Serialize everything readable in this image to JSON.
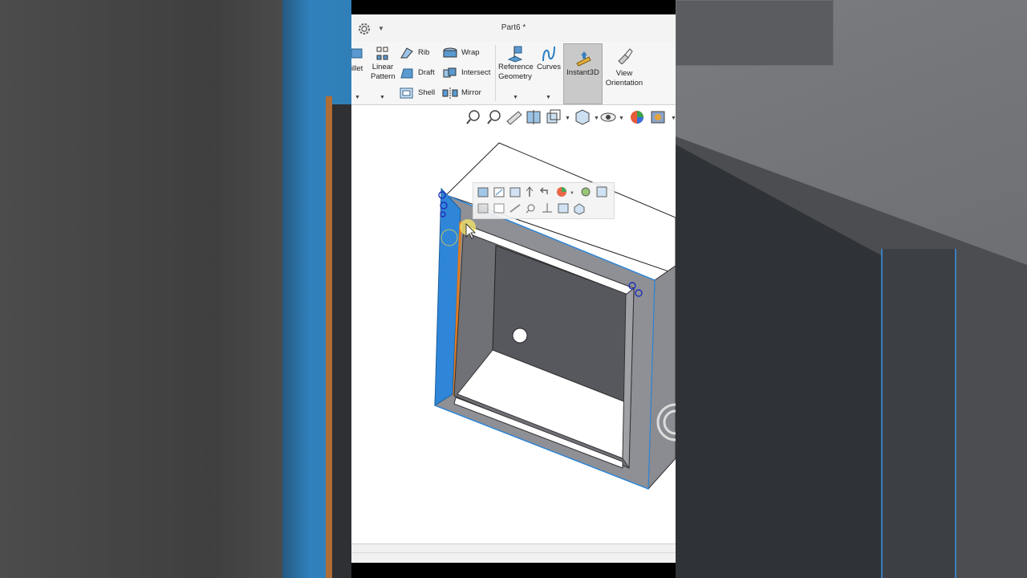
{
  "window": {
    "document_title": "Part6 *",
    "settings_icon": "gear-icon"
  },
  "ribbon": {
    "fillet_label": "illet",
    "linear_pattern_label_1": "Linear",
    "linear_pattern_label_2": "Pattern",
    "rib_label": "Rib",
    "draft_label": "Draft",
    "shell_label": "Shell",
    "wrap_label": "Wrap",
    "intersect_label": "Intersect",
    "mirror_label": "Mirror",
    "reference_geometry_label_1": "Reference",
    "reference_geometry_label_2": "Geometry",
    "curves_label": "Curves",
    "instant3d_label": "Instant3D",
    "view_orientation_label_1": "View",
    "view_orientation_label_2": "Orientation",
    "instant3d_active": true
  },
  "heads_up_toolbar": {
    "icons": [
      "zoom-to-fit-icon",
      "zoom-area-icon",
      "previous-view-icon",
      "section-view-icon",
      "view-orientation-icon",
      "display-style-icon",
      "hide-show-icon",
      "appearance-icon",
      "scene-icon"
    ]
  },
  "context_toolbar": {
    "row1": [
      "feature-icon",
      "edit-sketch-icon",
      "pattern-icon",
      "normal-to-icon",
      "rollback-icon",
      "appearance-icon",
      "zoom-icon",
      "hide-icon"
    ],
    "row2": [
      "section-icon",
      "sketch-icon",
      "measure-icon",
      "zoom-selection-icon",
      "mate-icon",
      "view-icon",
      "isometric-icon"
    ]
  },
  "model": {
    "selection_color": "#2f86d8",
    "highlight_color": "#e07a1f",
    "body_color": "#8a8c91"
  }
}
